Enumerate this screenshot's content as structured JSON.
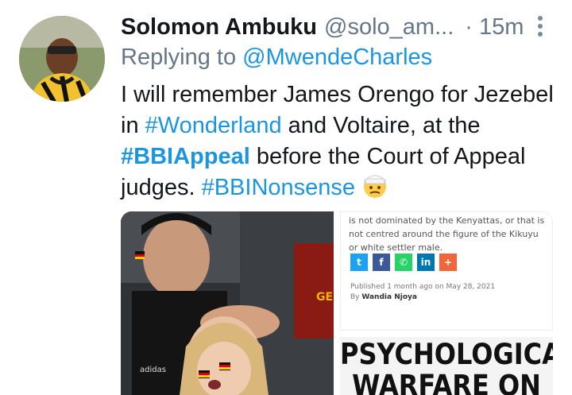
{
  "author": {
    "name": "Solomon Ambuku",
    "handle": "@solo_am...",
    "dot": "·",
    "time": "15m"
  },
  "reply": {
    "prefix": "Replying to ",
    "mention": "@MwendeCharles"
  },
  "text": {
    "part1": "I will remember James Orengo for Jezebel in ",
    "tag1": "#Wonderland",
    "part2": " and Voltaire, at the ",
    "tag2": "#BBIAppeal",
    "part3": " before the Court of Appeal judges. ",
    "tag3": "#BBINonsense",
    "emoji": "face-with-head-bandage"
  },
  "media": {
    "article_text": "is not dominated by the Kenyattas, or that is not centred around the figure of the Kikuyu or white settler male.",
    "share_buttons": [
      {
        "icon": "twitter-icon",
        "glyph": "t",
        "color": "#1da1f2"
      },
      {
        "icon": "facebook-icon",
        "glyph": "f",
        "color": "#3b5998"
      },
      {
        "icon": "whatsapp-icon",
        "glyph": "✆",
        "color": "#25d366"
      },
      {
        "icon": "linkedin-icon",
        "glyph": "in",
        "color": "#0077b5"
      },
      {
        "icon": "plus-icon",
        "glyph": "+",
        "color": "#f0653a"
      }
    ],
    "published_label": "Published ",
    "published_ago": "1 month ago",
    "published_on": " on May 28, 2021",
    "byline_prefix": "By ",
    "byline_author": "Wandia Njoya",
    "headline_line1": "PSYCHOLOGICAL",
    "headline_line2": "WARFARE ON",
    "photo_sign": "GE"
  }
}
